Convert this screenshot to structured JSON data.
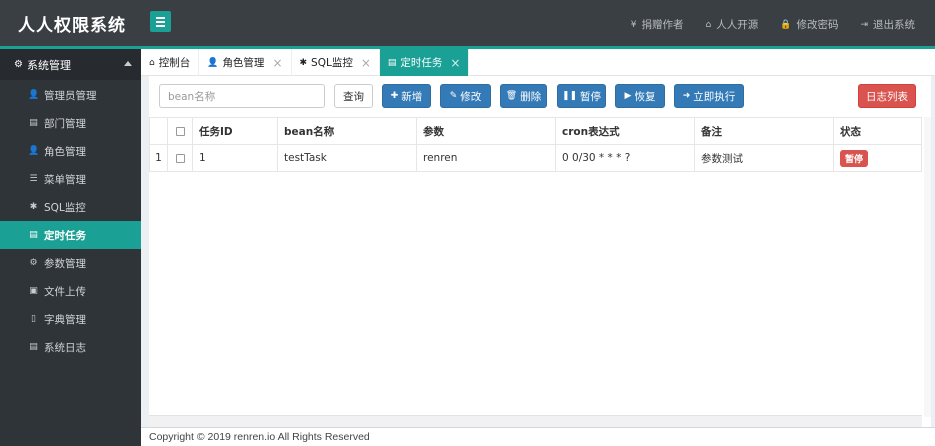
{
  "app": {
    "title": "人人权限系统"
  },
  "header_nav": [
    {
      "icon": "yen-icon",
      "glyph": "¥",
      "label": "捐赠作者"
    },
    {
      "icon": "home-icon",
      "glyph": "⌂",
      "label": "人人开源"
    },
    {
      "icon": "lock-icon",
      "glyph": "🔒",
      "label": "修改密码"
    },
    {
      "icon": "sign-out-icon",
      "glyph": "⇥",
      "label": "退出系统"
    }
  ],
  "sidebar": {
    "group_label": "系统管理",
    "items": [
      {
        "label": "管理员管理",
        "glyph": "👤"
      },
      {
        "label": "部门管理",
        "glyph": "▤"
      },
      {
        "label": "角色管理",
        "glyph": "👤"
      },
      {
        "label": "菜单管理",
        "glyph": "☰"
      },
      {
        "label": "SQL监控",
        "glyph": "✱"
      },
      {
        "label": "定时任务",
        "glyph": "▤"
      },
      {
        "label": "参数管理",
        "glyph": "⚙"
      },
      {
        "label": "文件上传",
        "glyph": "▣"
      },
      {
        "label": "字典管理",
        "glyph": "▯"
      },
      {
        "label": "系统日志",
        "glyph": "▤"
      }
    ],
    "active_index": 5
  },
  "tabs": [
    {
      "label": "控制台",
      "glyph": "⌂",
      "closable": false
    },
    {
      "label": "角色管理",
      "glyph": "👤",
      "closable": true
    },
    {
      "label": "SQL监控",
      "glyph": "✱",
      "closable": true
    },
    {
      "label": "定时任务",
      "glyph": "▤",
      "closable": true
    }
  ],
  "toolbar": {
    "search_placeholder": "bean名称",
    "query": "查询",
    "add": "新增",
    "edit": "修改",
    "delete": "删除",
    "pause": "暂停",
    "resume": "恢复",
    "run_now": "立即执行",
    "log_list": "日志列表"
  },
  "table": {
    "columns": [
      "任务ID",
      "bean名称",
      "参数",
      "cron表达式",
      "备注",
      "状态"
    ],
    "rows": [
      {
        "row_num": "1",
        "id": "1",
        "bean": "testTask",
        "params": "renren",
        "cron": "0 0/30 * * * ?",
        "remark": "参数测试",
        "status": "暂停"
      }
    ]
  },
  "footer": {
    "text": "Copyright © 2019  renren.io  All Rights Reserved"
  },
  "colors": {
    "accent": "#1aa094",
    "header": "#3a3f44",
    "sidebar": "#2f3438",
    "primary": "#337ab7",
    "danger": "#d9534f"
  }
}
